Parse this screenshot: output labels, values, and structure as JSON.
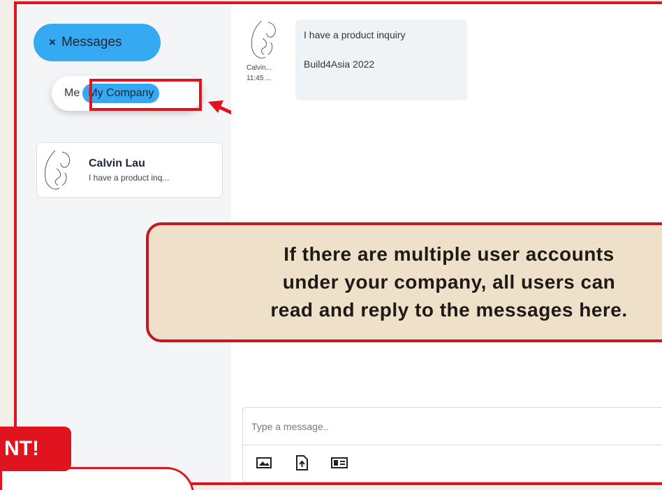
{
  "sidebar": {
    "messages_button": {
      "icon": "close-icon",
      "icon_glyph": "×",
      "label": "Messages"
    },
    "filter_toggle": {
      "option_me": "Me",
      "option_company": "My Company",
      "selected": "My Company"
    },
    "conversations": [
      {
        "name": "Calvin Lau",
        "preview": "I have a product inq..."
      }
    ]
  },
  "chat": {
    "message": {
      "sender_short": "Calvin...",
      "time_short": "11:45 ...",
      "text_line1": "I have a product inquiry",
      "text_line2": "Build4Asia 2022"
    },
    "composer": {
      "placeholder": "Type a message..",
      "tools": [
        "image-icon",
        "file-upload-icon",
        "contact-card-icon"
      ]
    }
  },
  "annotation": {
    "callout_line1": "If there are multiple user accounts",
    "callout_line2": "under your company, all users can",
    "callout_line3": "read and reply to the messages here.",
    "important_tag": "NT!"
  },
  "colors": {
    "accent_blue": "#35a9f2",
    "annotation_red": "#e0141e",
    "callout_bg": "#eee0c9"
  }
}
